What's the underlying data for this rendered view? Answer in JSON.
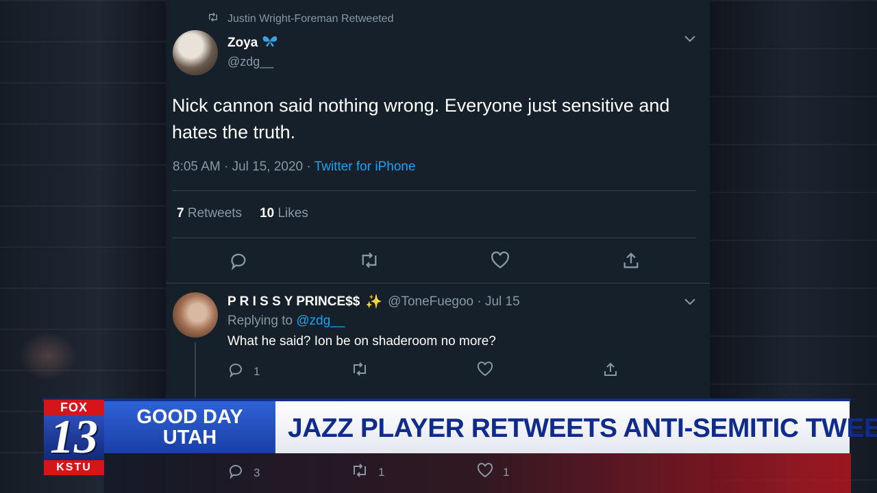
{
  "retweet_header": {
    "text": "Justin Wright-Foreman Retweeted"
  },
  "tweet": {
    "name": "Zoya",
    "handle": "@zdg__",
    "text": "Nick cannon said nothing wrong. Everyone just sensitive and hates the truth.",
    "time": "8:05 AM · Jul 15, 2020 ·",
    "source": "Twitter for iPhone",
    "retweets_count": "7",
    "retweets_label": "Retweets",
    "likes_count": "10",
    "likes_label": "Likes"
  },
  "reply": {
    "name": "P R I S S Y PRINCE$$",
    "handle_date": "@ToneFuegoo · Jul 15",
    "replying_label": "Replying to",
    "replying_handle": "@zdg__",
    "text": "What he said? Ion be on shaderoom no more?",
    "reply_count": "1"
  },
  "next_reply": {
    "reply_count": "3",
    "retweet_count": "1",
    "like_count": "1"
  },
  "lower_third": {
    "logo_top": "FOX",
    "logo_number": "13",
    "logo_bottom": "KSTU",
    "show_line1": "GOOD DAY",
    "show_line2": "UTAH",
    "headline": "JAZZ PLAYER RETWEETS ANTI-SEMITIC TWEET"
  },
  "icons": {
    "retweet": "retweet-icon",
    "reply": "reply-icon",
    "like": "heart-icon",
    "share": "share-icon",
    "verified_emoji": "butterfly-icon",
    "sparkles": "sparkles-icon"
  },
  "colors": {
    "background": "#15202b",
    "link": "#1da1f2",
    "muted": "#8899a6",
    "fox_red": "#d7141a",
    "fox_blue": "#1a3fa6"
  }
}
